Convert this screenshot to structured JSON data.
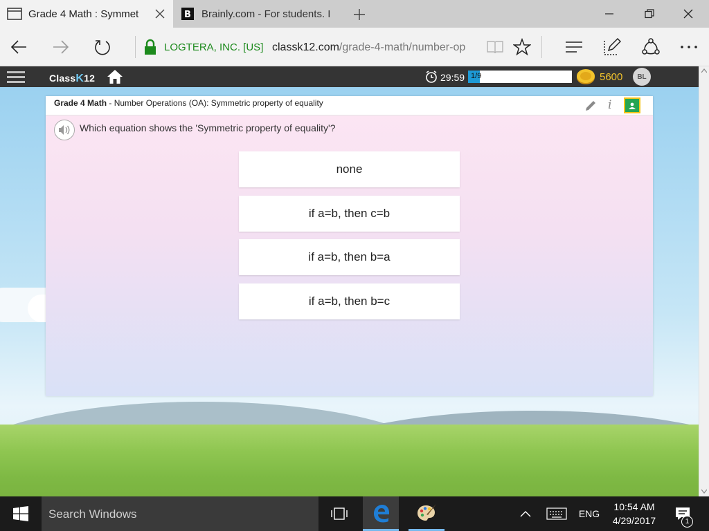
{
  "browser": {
    "tabs": [
      {
        "title": "Grade 4 Math : Symmet",
        "active": true
      },
      {
        "title": "Brainly.com - For students. I",
        "active": false
      }
    ],
    "brainly_glyph": "B",
    "address": {
      "org": "LOGTERA, INC. [US]",
      "domain": "classk12.com",
      "path": "/grade-4-math/number-op"
    }
  },
  "app": {
    "logo_prefix": "Class",
    "logo_k": "K",
    "logo_suffix": "12",
    "timer": "29:59",
    "progress": {
      "label": "1/9",
      "fraction": 0.111
    },
    "coins": "5600",
    "avatar": "BL"
  },
  "card": {
    "subject": "Grade 4 Math",
    "topic": " - Number Operations (OA): Symmetric property of equality",
    "info_glyph": "i",
    "question": "Which equation shows the 'Symmetric property of equality'?",
    "options": [
      "none",
      "if a=b, then c=b",
      "if a=b, then b=a",
      "if a=b, then b=c"
    ]
  },
  "taskbar": {
    "search_placeholder": "Search Windows",
    "language": "ENG",
    "time": "10:54 AM",
    "date": "4/29/2017",
    "notification_count": "1"
  },
  "colors": {
    "accent": "#1d9ad6",
    "secure": "#1c8a1c",
    "coins": "#f2c32c",
    "edge": "#1f7ed6"
  }
}
